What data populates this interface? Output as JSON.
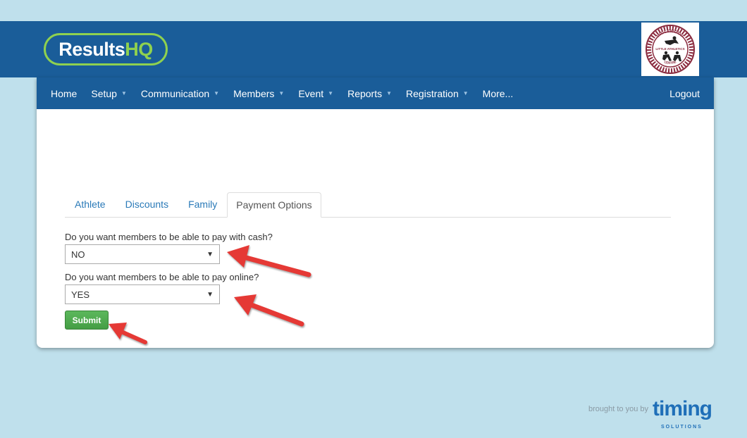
{
  "header": {
    "logo_main": "Results",
    "logo_accent": "HQ",
    "club_logo": {
      "top_text": "INGLEWOOD",
      "mid_text": "LITTLE ATHLETICS",
      "bottom_text": "CENTRE"
    }
  },
  "nav": {
    "items": [
      {
        "label": "Home",
        "dropdown": false
      },
      {
        "label": "Setup",
        "dropdown": true
      },
      {
        "label": "Communication",
        "dropdown": true
      },
      {
        "label": "Members",
        "dropdown": true
      },
      {
        "label": "Event",
        "dropdown": true
      },
      {
        "label": "Reports",
        "dropdown": true
      },
      {
        "label": "Registration",
        "dropdown": true
      },
      {
        "label": "More...",
        "dropdown": false
      }
    ],
    "logout": "Logout"
  },
  "tabs": [
    {
      "label": "Athlete",
      "active": false
    },
    {
      "label": "Discounts",
      "active": false
    },
    {
      "label": "Family",
      "active": false
    },
    {
      "label": "Payment Options",
      "active": true
    }
  ],
  "form": {
    "cash_question": "Do you want members to be able to pay with cash?",
    "cash_value": "NO",
    "online_question": "Do you want members to be able to pay online?",
    "online_value": "YES",
    "submit_label": "Submit"
  },
  "footer": {
    "brought_text": "brought to you by",
    "brand": "timing",
    "brand_sub": "SOLUTIONS"
  },
  "colors": {
    "header_blue": "#1a5d99",
    "accent_green": "#8fd14f",
    "submit_green": "#5cb85c",
    "annotation_red": "#e53935"
  },
  "icons": {
    "dropdown_caret": "caret-down-icon",
    "select_arrow": "triangle-down-icon",
    "annotation": "red-arrow-icon"
  }
}
